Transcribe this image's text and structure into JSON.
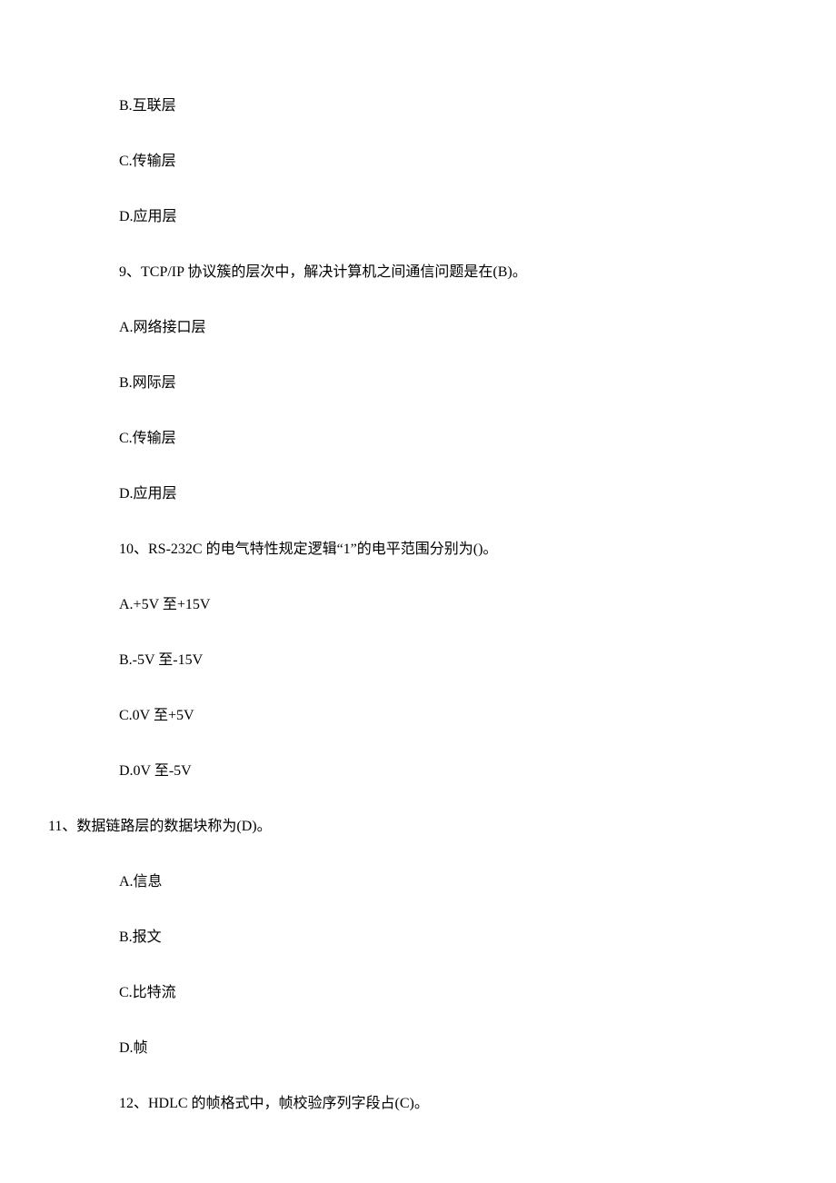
{
  "lines": [
    {
      "text": "B.互联层",
      "cls": ""
    },
    {
      "text": "C.传输层",
      "cls": ""
    },
    {
      "text": "D.应用层",
      "cls": ""
    },
    {
      "text": "9、TCP/IP 协议簇的层次中，解决计算机之间通信问题是在(B)。",
      "cls": ""
    },
    {
      "text": "A.网络接口层",
      "cls": ""
    },
    {
      "text": "B.网际层",
      "cls": ""
    },
    {
      "text": "C.传输层",
      "cls": ""
    },
    {
      "text": "D.应用层",
      "cls": ""
    },
    {
      "text": "10、RS-232C 的电气特性规定逻辑“1”的电平范围分别为()。",
      "cls": ""
    },
    {
      "text": "A.+5V 至+15V",
      "cls": ""
    },
    {
      "text": "B.-5V 至-15V",
      "cls": ""
    },
    {
      "text": "C.0V 至+5V",
      "cls": ""
    },
    {
      "text": "D.0V 至-5V",
      "cls": ""
    },
    {
      "text": "11、数据链路层的数据块称为(D)。",
      "cls": "left-line"
    },
    {
      "text": "A.信息",
      "cls": ""
    },
    {
      "text": "B.报文",
      "cls": ""
    },
    {
      "text": "C.比特流",
      "cls": ""
    },
    {
      "text": "D.帧",
      "cls": ""
    },
    {
      "text": "12、HDLC 的帧格式中，帧校验序列字段占(C)。",
      "cls": ""
    }
  ]
}
